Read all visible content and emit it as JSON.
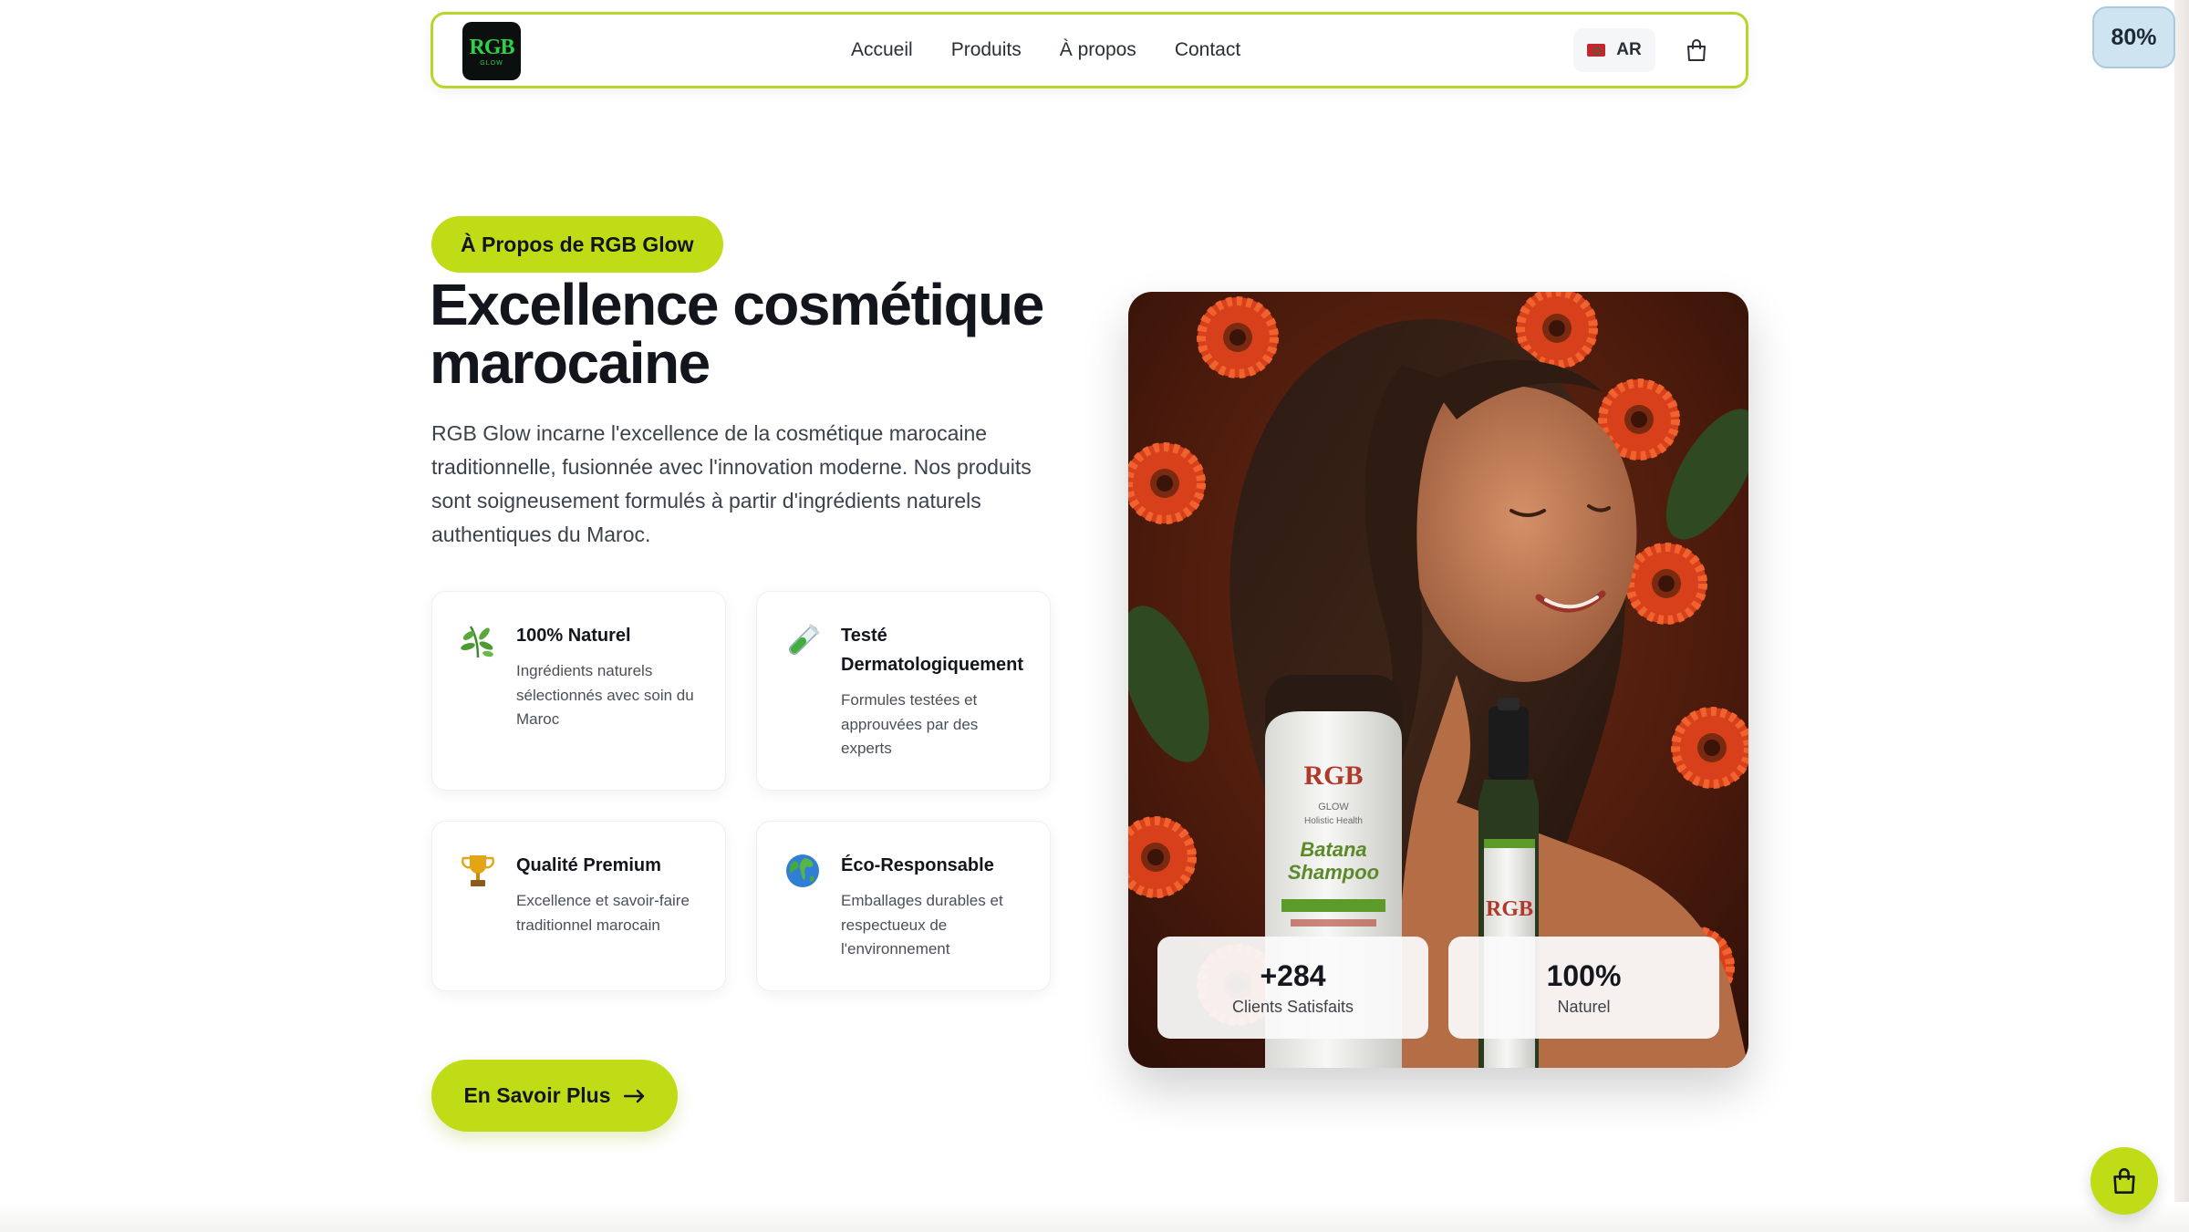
{
  "nav": {
    "logo_text": "RGB",
    "logo_sub": "GLOW",
    "links": [
      "Accueil",
      "Produits",
      "À propos",
      "Contact"
    ],
    "lang_label": "AR"
  },
  "zoom": "80%",
  "about": {
    "badge": "À Propos de RGB Glow",
    "title": "Excellence cosmétique marocaine",
    "description": "RGB Glow incarne l'excellence de la cosmétique marocaine traditionnelle, fusionnée avec l'innovation moderne. Nos produits sont soigneusement formulés à partir d'ingrédients naturels authentiques du Maroc.",
    "features": [
      {
        "icon": "herb-icon",
        "title": "100% Naturel",
        "desc": "Ingrédients naturels sélectionnés avec soin du Maroc"
      },
      {
        "icon": "test-tube-icon",
        "title": "Testé Dermatologiquement",
        "desc": "Formules testées et approuvées par des experts"
      },
      {
        "icon": "trophy-icon",
        "title": "Qualité Premium",
        "desc": "Excellence et savoir-faire traditionnel marocain"
      },
      {
        "icon": "globe-icon",
        "title": "Éco-Responsable",
        "desc": "Emballages durables et respectueux de l'environnement"
      }
    ],
    "cta_label": "En Savoir Plus"
  },
  "hero": {
    "bottle_brand": "RGB",
    "bottle_brand_sub": "GLOW",
    "bottle_tagline": "Holistic Health",
    "bottle_product_1": "Batana",
    "bottle_product_2": "Shampoo",
    "stats": [
      {
        "value": "+284",
        "label": "Clients Satisfaits"
      },
      {
        "value": "100%",
        "label": "Naturel"
      }
    ]
  },
  "colors": {
    "accent": "#bfdc16",
    "nav_border": "#b8d62a",
    "heading": "#12161c"
  }
}
